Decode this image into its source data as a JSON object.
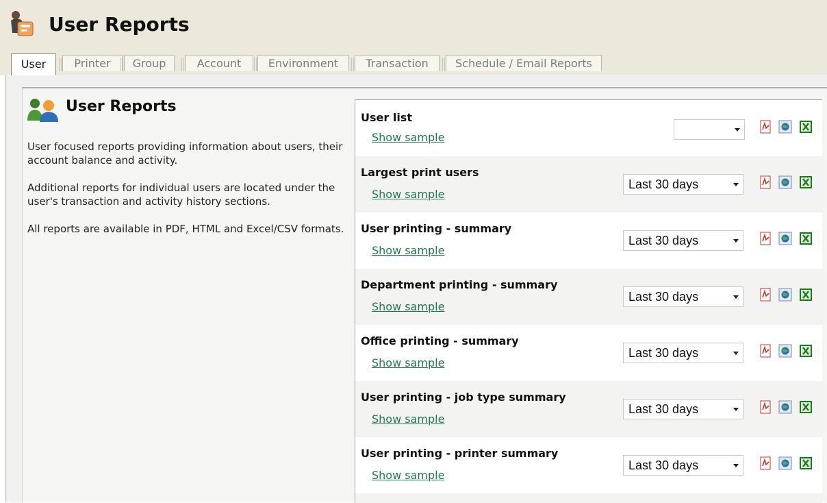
{
  "header": {
    "title": "User Reports"
  },
  "tabs": [
    {
      "label": "User"
    },
    {
      "label": "Printer"
    },
    {
      "label": "Group"
    },
    {
      "label": "Account"
    },
    {
      "label": "Environment"
    },
    {
      "label": "Transaction"
    },
    {
      "label": "Schedule / Email Reports"
    }
  ],
  "section": {
    "title": "User Reports",
    "paragraphs": [
      "User focused reports providing information about users, their account balance and activity.",
      "Additional reports for individual users are located under the user's transaction and activity history sections.",
      "All reports are available in PDF, HTML and Excel/CSV formats."
    ]
  },
  "reports": [
    {
      "name": "User list",
      "sample": "Show sample",
      "range": ""
    },
    {
      "name": "Largest print users",
      "sample": "Show sample",
      "range": "Last 30 days"
    },
    {
      "name": "User printing - summary",
      "sample": "Show sample",
      "range": "Last 30 days"
    },
    {
      "name": "Department printing - summary",
      "sample": "Show sample",
      "range": "Last 30 days"
    },
    {
      "name": "Office printing - summary",
      "sample": "Show sample",
      "range": "Last 30 days"
    },
    {
      "name": "User printing - job type summary",
      "sample": "Show sample",
      "range": "Last 30 days"
    },
    {
      "name": "User printing - printer summary",
      "sample": "Show sample",
      "range": "Last 30 days"
    }
  ],
  "icons": {
    "app": "printer-user-icon",
    "section": "users-group-icon",
    "formats": [
      "pdf-icon",
      "html-globe-icon",
      "excel-icon"
    ]
  },
  "colors": {
    "link": "#1f7a4e",
    "header_bg": "#ece9dc",
    "pdf": "#c0392b",
    "excel": "#1e7a1e",
    "html": "#2a6fb5"
  }
}
